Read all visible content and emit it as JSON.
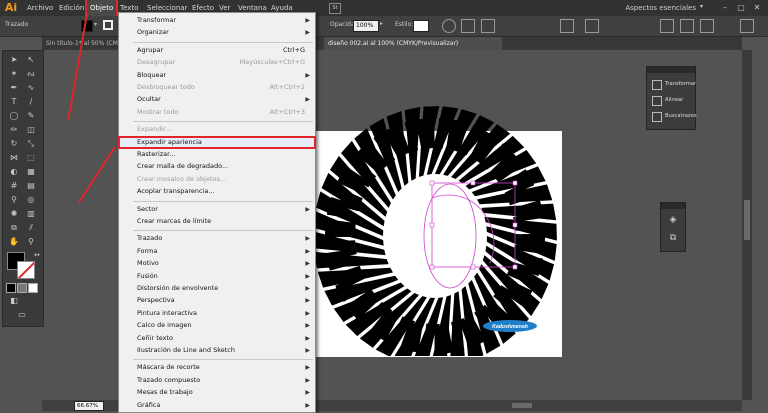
{
  "app": {
    "logo": "Ai"
  },
  "menubar": {
    "items": [
      "Archivo",
      "Edición",
      "Objeto",
      "Texto",
      "Seleccionar",
      "Efecto",
      "Ver",
      "Ventana",
      "Ayuda"
    ],
    "workspace": "Aspectos esenciales",
    "window_controls": [
      "–",
      "▢",
      "✕"
    ]
  },
  "controlbar": {
    "selection_label": "Trazado",
    "opacity_label": "Opacidad:",
    "opacity_value": "100%",
    "style_label": "Estilo:"
  },
  "doc_tabs": [
    {
      "label": "Sin título-1* al 50% (CMYK/Previsualizar)",
      "current": false
    },
    {
      "label": "diseño 002.ai al 100% (CMYK/Previsualizar)",
      "current": true
    }
  ],
  "object_menu": {
    "items": [
      {
        "label": "Transformar",
        "shortcut": "",
        "submenu": true,
        "disabled": false,
        "highlight": false
      },
      {
        "label": "Organizar",
        "shortcut": "",
        "submenu": true,
        "disabled": false,
        "highlight": false
      },
      {
        "separator": true
      },
      {
        "label": "Agrupar",
        "shortcut": "Ctrl+G",
        "submenu": false,
        "disabled": false,
        "highlight": false
      },
      {
        "label": "Desagrupar",
        "shortcut": "Mayúsculas+Ctrl+G",
        "submenu": false,
        "disabled": true,
        "highlight": false
      },
      {
        "label": "Bloquear",
        "shortcut": "",
        "submenu": true,
        "disabled": false,
        "highlight": false
      },
      {
        "label": "Desbloquear todo",
        "shortcut": "Alt+Ctrl+2",
        "submenu": false,
        "disabled": true,
        "highlight": false
      },
      {
        "label": "Ocultar",
        "shortcut": "",
        "submenu": true,
        "disabled": false,
        "highlight": false
      },
      {
        "label": "Mostrar todo",
        "shortcut": "Alt+Ctrl+3",
        "submenu": false,
        "disabled": true,
        "highlight": false
      },
      {
        "separator": true
      },
      {
        "label": "Expandir...",
        "shortcut": "",
        "submenu": false,
        "disabled": true,
        "highlight": false
      },
      {
        "label": "Expandir apariencia",
        "shortcut": "",
        "submenu": false,
        "disabled": false,
        "highlight": true
      },
      {
        "label": "Rasterizar...",
        "shortcut": "",
        "submenu": false,
        "disabled": false,
        "highlight": false
      },
      {
        "label": "Crear malla de degradado...",
        "shortcut": "",
        "submenu": false,
        "disabled": false,
        "highlight": false
      },
      {
        "label": "Crear mosaico de objetos...",
        "shortcut": "",
        "submenu": false,
        "disabled": true,
        "highlight": false
      },
      {
        "label": "Acoplar transparencia...",
        "shortcut": "",
        "submenu": false,
        "disabled": false,
        "highlight": false
      },
      {
        "separator": true
      },
      {
        "label": "Sector",
        "shortcut": "",
        "submenu": true,
        "disabled": false,
        "highlight": false
      },
      {
        "label": "Crear marcas de límite",
        "shortcut": "",
        "submenu": false,
        "disabled": false,
        "highlight": false
      },
      {
        "separator": true
      },
      {
        "label": "Trazado",
        "shortcut": "",
        "submenu": true,
        "disabled": false,
        "highlight": false
      },
      {
        "label": "Forma",
        "shortcut": "",
        "submenu": true,
        "disabled": false,
        "highlight": false
      },
      {
        "label": "Motivo",
        "shortcut": "",
        "submenu": true,
        "disabled": false,
        "highlight": false
      },
      {
        "label": "Fusión",
        "shortcut": "",
        "submenu": true,
        "disabled": false,
        "highlight": false
      },
      {
        "label": "Distorsión de envolvente",
        "shortcut": "",
        "submenu": true,
        "disabled": false,
        "highlight": false
      },
      {
        "label": "Perspectiva",
        "shortcut": "",
        "submenu": true,
        "disabled": false,
        "highlight": false
      },
      {
        "label": "Pintura interactiva",
        "shortcut": "",
        "submenu": true,
        "disabled": false,
        "highlight": false
      },
      {
        "label": "Calco de imagen",
        "shortcut": "",
        "submenu": true,
        "disabled": false,
        "highlight": false
      },
      {
        "label": "Ceñir texto",
        "shortcut": "",
        "submenu": true,
        "disabled": false,
        "highlight": false
      },
      {
        "label": "Ilustración de Line and Sketch",
        "shortcut": "",
        "submenu": true,
        "disabled": false,
        "highlight": false
      },
      {
        "separator": true
      },
      {
        "label": "Máscara de recorte",
        "shortcut": "",
        "submenu": true,
        "disabled": false,
        "highlight": false
      },
      {
        "label": "Trazado compuesto",
        "shortcut": "",
        "submenu": true,
        "disabled": false,
        "highlight": false
      },
      {
        "label": "Mesas de trabajo",
        "shortcut": "",
        "submenu": true,
        "disabled": false,
        "highlight": false
      },
      {
        "label": "Gráfica",
        "shortcut": "",
        "submenu": true,
        "disabled": false,
        "highlight": false
      }
    ]
  },
  "panel": {
    "items": [
      "Transformar",
      "Alinear",
      "Buscatrazos"
    ]
  },
  "artwork": {
    "watermark": "Kadoshmenah"
  },
  "status": {
    "zoom": "66.67%"
  },
  "colors": {
    "accent": "#e0252b",
    "app_bg": "#535353",
    "menu_bg": "#f0f0f0",
    "selection": "#d040d0"
  }
}
